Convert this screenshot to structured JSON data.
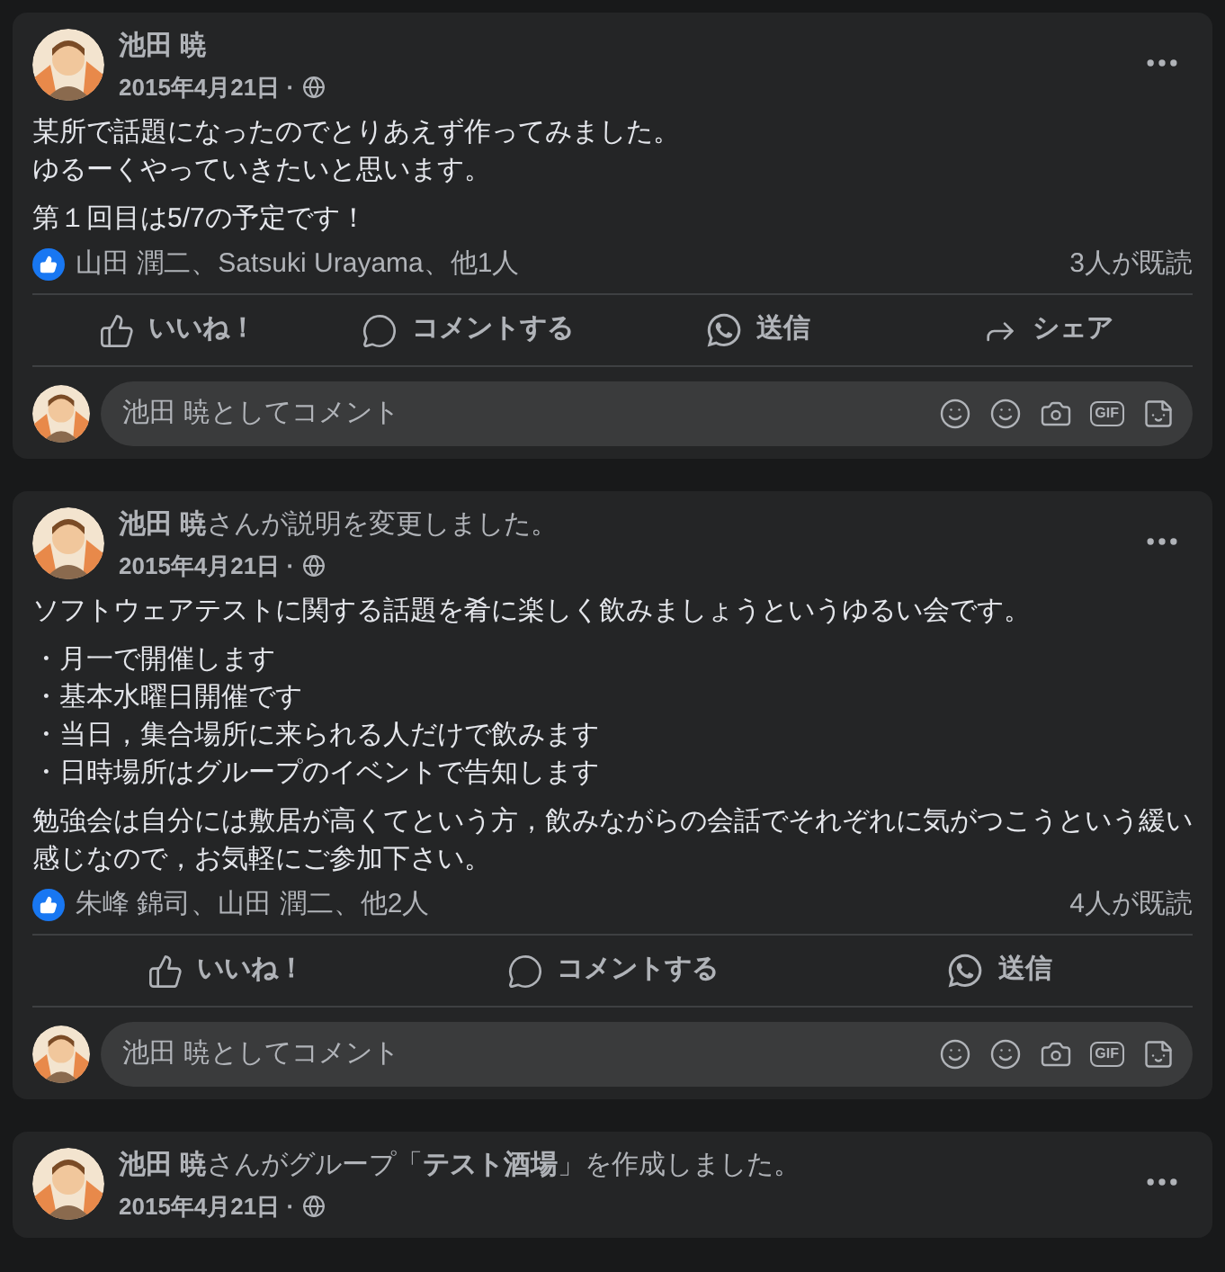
{
  "posts": [
    {
      "header": "**池田 暁**",
      "date": "2015年4月21日 ·",
      "body": [
        [
          "某所で話題になったのでとりあえず作ってみました。",
          "ゆるーくやっていきたいと思います。"
        ],
        [
          "第１回目は5/7の予定です！"
        ]
      ],
      "reactions": {
        "names": "山田 潤二、Satsuki Urayama、他1人",
        "seen": "3人が既読"
      },
      "actions": [
        {
          "kind": "like",
          "label": "いいね！"
        },
        {
          "kind": "comment",
          "label": "コメントする"
        },
        {
          "kind": "send",
          "label": "送信"
        },
        {
          "kind": "share",
          "label": "シェア"
        }
      ],
      "comment": {
        "placeholder": "池田 暁としてコメント",
        "gif": "GIF"
      }
    },
    {
      "header": "**池田 暁**さんが説明を変更しました。",
      "date": "2015年4月21日 ·",
      "body": [
        [
          "ソフトウェアテストに関する話題を肴に楽しく飲みましょうというゆるい会です。"
        ],
        [
          "・月一で開催します",
          "・基本水曜日開催です",
          "・当日，集合場所に来られる人だけで飲みます",
          "・日時場所はグループのイベントで告知します"
        ],
        [
          "勉強会は自分には敷居が高くてという方，飲みながらの会話でそれぞれに気がつこうという緩い感じなので，お気軽にご参加下さい。"
        ]
      ],
      "reactions": {
        "names": "朱峰 錦司、山田 潤二、他2人",
        "seen": "4人が既読"
      },
      "actions": [
        {
          "kind": "like",
          "label": "いいね！"
        },
        {
          "kind": "comment",
          "label": "コメントする"
        },
        {
          "kind": "send",
          "label": "送信"
        }
      ],
      "comment": {
        "placeholder": "池田 暁としてコメント",
        "gif": "GIF"
      }
    },
    {
      "header": "**池田 暁**さんがグループ「**テスト酒場**」を作成しました。",
      "date": "2015年4月21日 ·"
    }
  ]
}
